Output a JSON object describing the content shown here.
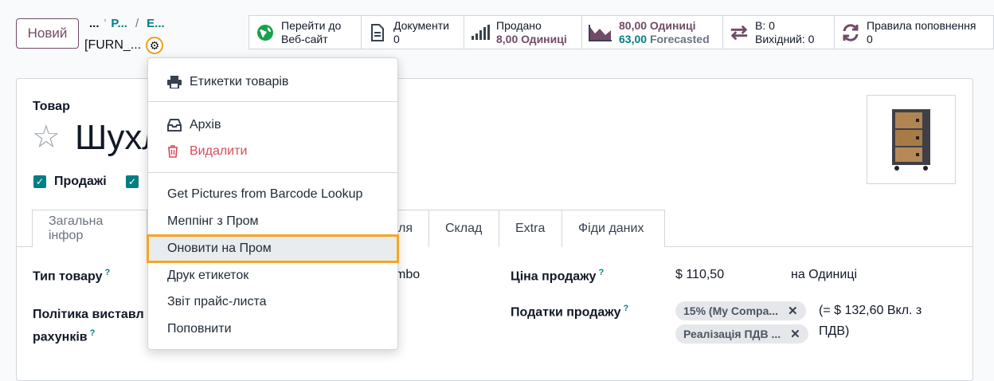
{
  "header": {
    "new_button": "Новий",
    "breadcrumb": {
      "dots": "...",
      "crumb1": "P...",
      "sep": "/",
      "crumb2": "E..."
    },
    "record_name": "[FURN_..."
  },
  "stat_buttons": [
    {
      "icon": "globe-icon",
      "line1": "Перейти до",
      "line2": "Веб-сайт"
    },
    {
      "icon": "document-icon",
      "line1": "Документи",
      "line2": "0"
    },
    {
      "icon": "bar-chart-icon",
      "line1": "Продано",
      "line2": "8,00 Одиниці"
    },
    {
      "icon": "area-chart-icon",
      "line1": "80,00 Одиниці",
      "line2_value": "63,00",
      "line2_label": "Forecasted"
    },
    {
      "icon": "transfer-arrows-icon",
      "line1": "В: 0",
      "line2": "Вихідний: 0"
    },
    {
      "icon": "refresh-icon",
      "line1": "Правила поповнення",
      "line2": "0"
    }
  ],
  "form": {
    "section_label": "Товар",
    "title": "Шухл",
    "checkbox_sales": "Продажі",
    "tabs": [
      "Загальна інфор",
      "ля",
      "Склад",
      "Extra",
      "Фіди даних"
    ],
    "fields": {
      "product_type_label": "Тип товару",
      "product_type_value": "mbo",
      "invoice_policy_label_1": "Політика виставл",
      "invoice_policy_label_2": "рахунків",
      "sale_price_label": "Ціна продажу",
      "sale_price_value": "$ 110,50",
      "sale_price_unit": "на Одиниці",
      "taxes_label": "Податки продажу",
      "tax_tags": [
        "15% (My Compa...",
        "Реалізація ПДВ ..."
      ],
      "tax_note_1": "(= $ 132,60 Вкл. з",
      "tax_note_2": "ПДВ)"
    }
  },
  "menu": {
    "items": [
      {
        "label": "Етикетки товарів",
        "icon": "print-icon"
      },
      {
        "label": "Архів",
        "icon": "inbox-icon"
      },
      {
        "label": "Видалити",
        "icon": "trash-icon"
      },
      {
        "label": "Get Pictures from Barcode Lookup"
      },
      {
        "label": "Меппінг з Пром"
      },
      {
        "label": "Оновити на Пром"
      },
      {
        "label": "Друк етикеток"
      },
      {
        "label": "Звіт прайс-листа"
      },
      {
        "label": "Поповнити"
      }
    ]
  },
  "colors": {
    "brand": "#714b67",
    "accent": "#017e84",
    "danger": "#d44c59",
    "highlight_border": "#f5a623"
  }
}
